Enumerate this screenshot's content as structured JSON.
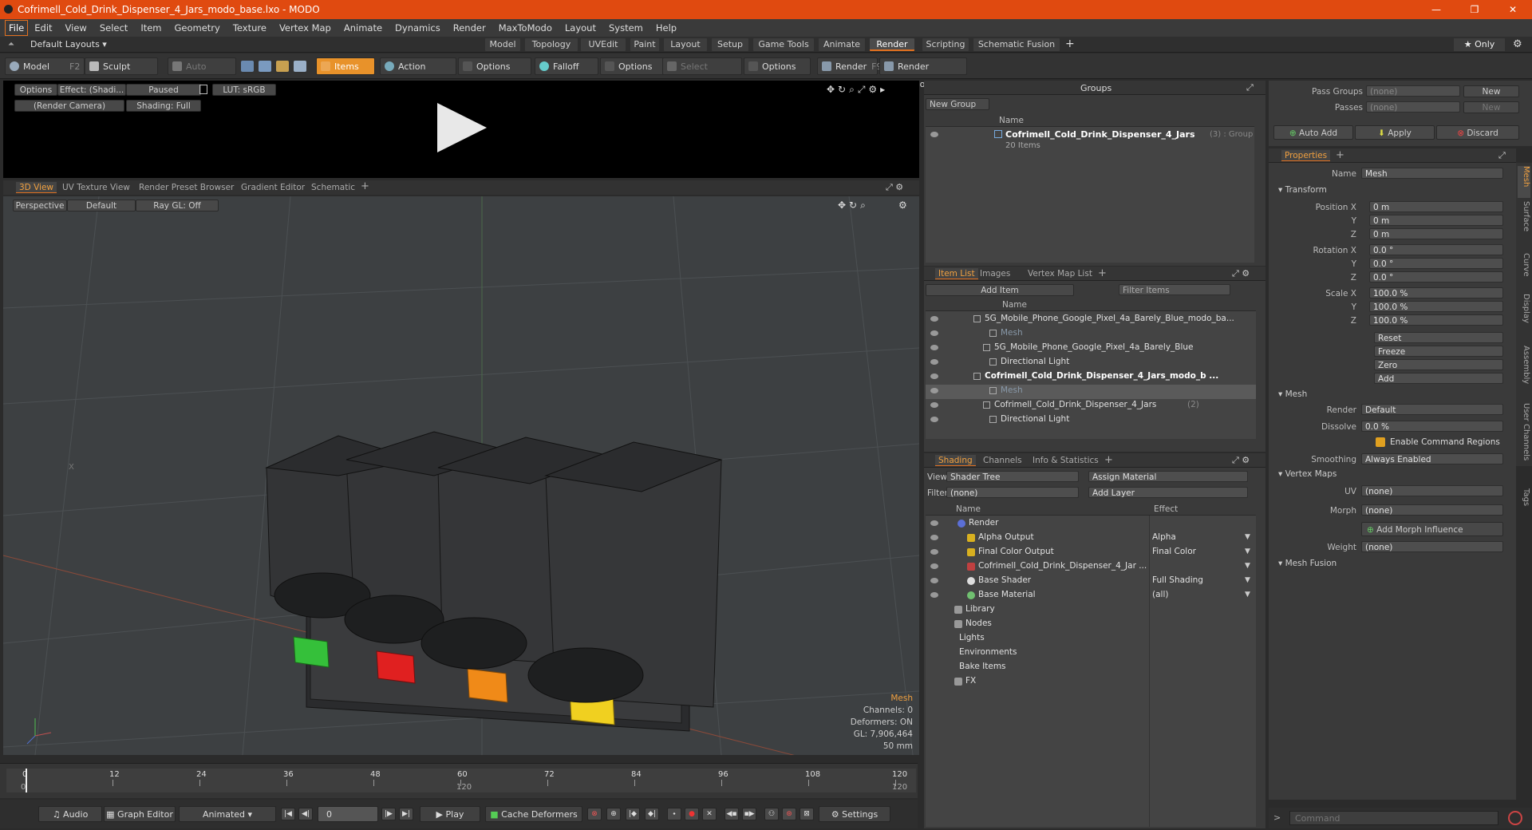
{
  "window": {
    "title": "Cofrimell_Cold_Drink_Dispenser_4_Jars_modo_base.lxo - MODO"
  },
  "menu": [
    "File",
    "Edit",
    "View",
    "Select",
    "Item",
    "Geometry",
    "Texture",
    "Vertex Map",
    "Animate",
    "Dynamics",
    "Render",
    "MaxToModo",
    "Layout",
    "System",
    "Help"
  ],
  "layout_tabs": {
    "layouts_label": "Default Layouts ▾",
    "tabs": [
      "Model",
      "Topology",
      "UVEdit",
      "Paint",
      "Layout",
      "Setup",
      "Game Tools",
      "Animate",
      "Render",
      "Scripting",
      "Schematic Fusion"
    ],
    "active": "Render",
    "only_label": "★ Only"
  },
  "toolbar": {
    "model": "Model",
    "model_key": "F2",
    "sculpt": "Sculpt",
    "auto_select": "Auto Select",
    "items": "Items",
    "action_center": "Action Center",
    "options1": "Options",
    "falloff": "Falloff",
    "options2": "Options",
    "select_through": "Select Through",
    "options3": "Options",
    "render": "Render",
    "render_key": "F9",
    "render_window": "Render Window"
  },
  "render_preview": {
    "options": "Options",
    "effect": "Effect: (Shadi...",
    "paused": "Paused",
    "lut": "LUT: sRGB",
    "camera": "(Render Camera)",
    "shading": "Shading: Full"
  },
  "viewport_tabs": [
    "3D View",
    "UV Texture View",
    "Render Preset Browser",
    "Gradient Editor",
    "Schematic"
  ],
  "viewport": {
    "perspective": "Perspective",
    "default": "Default",
    "raygl": "Ray GL: Off",
    "info": [
      "Mesh",
      "Channels: 0",
      "Deformers: ON",
      "GL: 7,906,464",
      "50 mm"
    ],
    "axis_x": "X"
  },
  "timeline": {
    "ticks": [
      "0",
      "12",
      "24",
      "36",
      "48",
      "60",
      "72",
      "84",
      "96",
      "108",
      "120"
    ],
    "sub_ticks": [
      "0",
      "120",
      "120"
    ]
  },
  "bottom": {
    "audio": "Audio",
    "graph_editor": "Graph Editor",
    "animated": "Animated",
    "frame": "0",
    "play": "Play",
    "cache": "Cache Deformers",
    "settings": "Settings"
  },
  "groups": {
    "title": "Groups",
    "new_group": "New Group",
    "col_name": "Name",
    "item_name": "Cofrimell_Cold_Drink_Dispenser_4_Jars",
    "item_count": "(3) : Group",
    "item_sub": "20 Items"
  },
  "item_list": {
    "tabs": [
      "Item List",
      "Images",
      "Vertex Map List"
    ],
    "add_item": "Add Item",
    "filter": "Filter Items",
    "col_name": "Name",
    "rows": [
      "5G_Mobile_Phone_Google_Pixel_4a_Barely_Blue_modo_ba...",
      "Mesh",
      "5G_Mobile_Phone_Google_Pixel_4a_Barely_Blue",
      "Directional Light",
      "Cofrimell_Cold_Drink_Dispenser_4_Jars_modo_b ...",
      "Mesh",
      "Cofrimell_Cold_Drink_Dispenser_4_Jars",
      "Directional Light"
    ],
    "count2": "(2)"
  },
  "shading": {
    "tabs": [
      "Shading",
      "Channels",
      "Info & Statistics"
    ],
    "view_label": "View",
    "view_value": "Shader Tree",
    "assign": "Assign Material",
    "filter_label": "Filter",
    "filter_value": "(none)",
    "add_layer": "Add Layer",
    "col_name": "Name",
    "col_effect": "Effect",
    "rows": [
      {
        "name": "Render",
        "effect": ""
      },
      {
        "name": "Alpha Output",
        "effect": "Alpha"
      },
      {
        "name": "Final Color Output",
        "effect": "Final Color"
      },
      {
        "name": "Cofrimell_Cold_Drink_Dispenser_4_Jar ...",
        "effect": ""
      },
      {
        "name": "Base Shader",
        "effect": "Full Shading"
      },
      {
        "name": "Base Material",
        "effect": "(all)"
      },
      {
        "name": "Library",
        "effect": ""
      },
      {
        "name": "Nodes",
        "effect": ""
      },
      {
        "name": "Lights",
        "effect": ""
      },
      {
        "name": "Environments",
        "effect": ""
      },
      {
        "name": "Bake Items",
        "effect": ""
      },
      {
        "name": "FX",
        "effect": ""
      }
    ]
  },
  "passes": {
    "pass_groups": "Pass Groups",
    "passes": "Passes",
    "none": "(none)",
    "new": "New",
    "auto_add": "Auto Add",
    "apply": "Apply",
    "discard": "Discard"
  },
  "properties": {
    "tab": "Properties",
    "name_label": "Name",
    "name_value": "Mesh",
    "transform": "Transform",
    "position_label": "Position X",
    "rotation_label": "Rotation X",
    "scale_label": "Scale X",
    "y": "Y",
    "z": "Z",
    "pos": [
      "0 m",
      "0 m",
      "0 m"
    ],
    "rot": [
      "0.0 °",
      "0.0 °",
      "0.0 °"
    ],
    "scale": [
      "100.0 %",
      "100.0 %",
      "100.0 %"
    ],
    "reset": "Reset",
    "freeze": "Freeze",
    "zero": "Zero",
    "add": "Add",
    "mesh": "Mesh",
    "render_label": "Render",
    "render_value": "Default",
    "dissolve_label": "Dissolve",
    "dissolve_value": "0.0 %",
    "enable_cmd": "Enable Command Regions",
    "smoothing_label": "Smoothing",
    "smoothing_value": "Always Enabled",
    "vertex_maps": "Vertex Maps",
    "uv_label": "UV",
    "uv_value": "(none)",
    "morph_label": "Morph",
    "morph_value": "(none)",
    "add_morph": "Add Morph Influence",
    "weight_label": "Weight",
    "weight_value": "(none)",
    "mesh_fusion": "Mesh Fusion",
    "side_tabs": [
      "Mesh",
      "Surface",
      "Curve",
      "Display",
      "Assembly",
      "User Channels",
      "Tags"
    ]
  },
  "command": {
    "placeholder": "Command"
  },
  "colors": {
    "accent": "#e07020",
    "titlebar": "#e04a10"
  }
}
